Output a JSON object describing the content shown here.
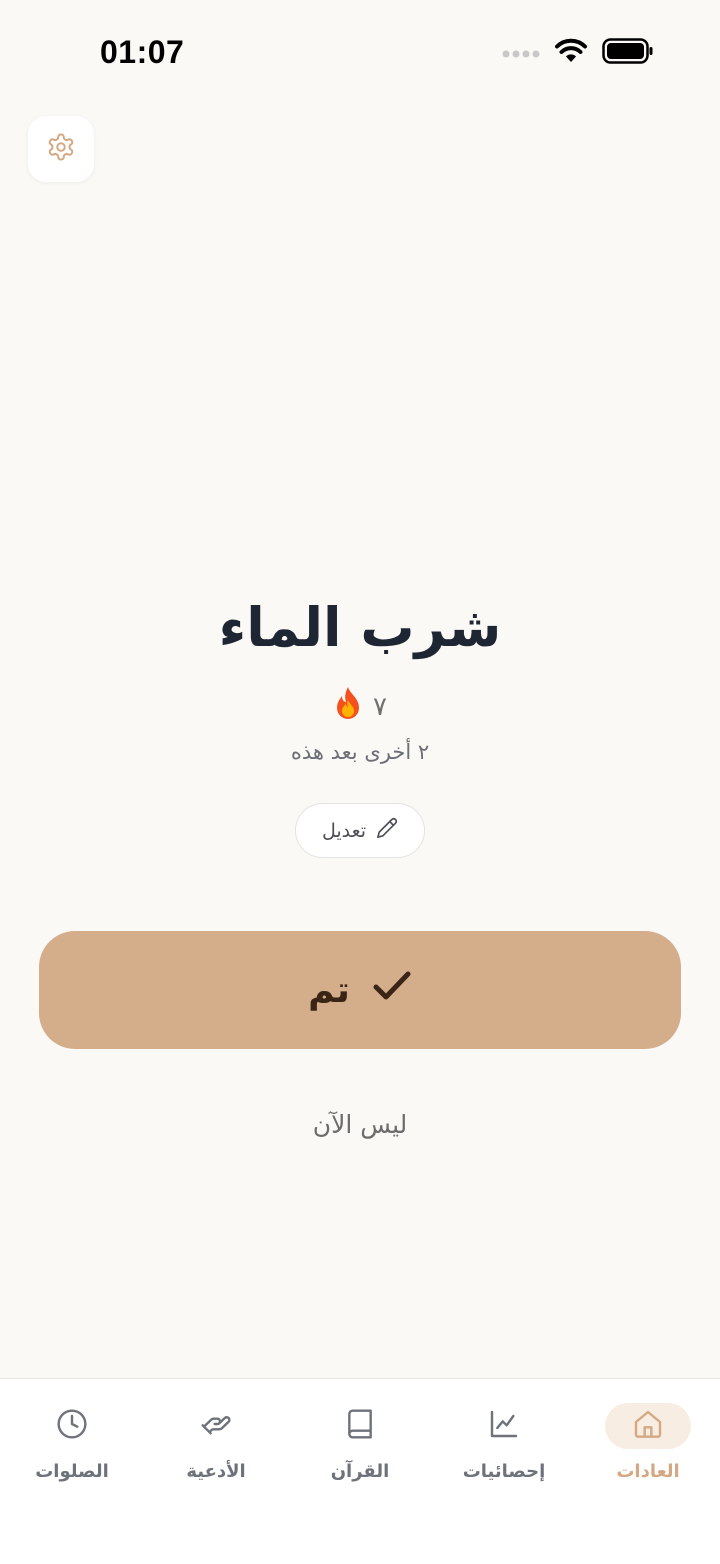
{
  "status_bar": {
    "time": "01:07"
  },
  "habit": {
    "title": "شرب الماء",
    "streak_count": "٧",
    "streak_icon": "fire-emoji",
    "remaining_text": "٢ أخرى بعد هذه"
  },
  "actions": {
    "edit_label": "تعديل",
    "done_label": "تم",
    "not_now_label": "ليس الآن"
  },
  "tabs": [
    {
      "label": "العادات",
      "icon": "home-icon",
      "active": true
    },
    {
      "label": "إحصائيات",
      "icon": "chart-icon",
      "active": false
    },
    {
      "label": "القرآن",
      "icon": "book-icon",
      "active": false
    },
    {
      "label": "الأدعية",
      "icon": "hands-icon",
      "active": false
    },
    {
      "label": "الصلوات",
      "icon": "clock-icon",
      "active": false
    }
  ],
  "colors": {
    "accent": "#d4ae8a",
    "accent_text": "#d3a883",
    "background": "#fbf9f6"
  }
}
